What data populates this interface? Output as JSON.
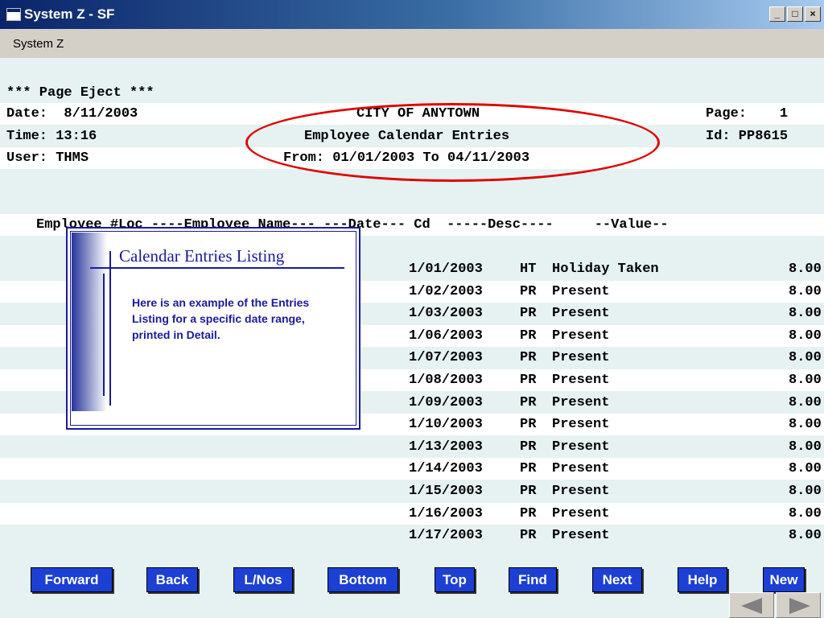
{
  "window": {
    "title": "System Z - SF",
    "min_glyph": "_",
    "max_glyph": "□",
    "close_glyph": "×"
  },
  "menubar": {
    "menu_label": "System Z"
  },
  "report": {
    "page_eject": "*** Page Eject ***",
    "date_line": "Date:  8/11/2003",
    "time_line": "Time: 13:16",
    "user_line": "User: THMS",
    "org": "CITY OF ANYTOWN",
    "report_title": "Employee Calendar Entries",
    "range": "From: 01/01/2003 To 04/11/2003",
    "page_line": "Page:    1",
    "id_line": "Id: PP8615",
    "column_header": "Employee #Loc ----Employee Name--- ---Date--- Cd  -----Desc----     --Value--",
    "rows": [
      {
        "date": "1/01/2003",
        "cd": "HT",
        "desc": "Holiday Taken",
        "value": "8.00"
      },
      {
        "date": "1/02/2003",
        "cd": "PR",
        "desc": "Present",
        "value": "8.00"
      },
      {
        "date": "1/03/2003",
        "cd": "PR",
        "desc": "Present",
        "value": "8.00"
      },
      {
        "date": "1/06/2003",
        "cd": "PR",
        "desc": "Present",
        "value": "8.00"
      },
      {
        "date": "1/07/2003",
        "cd": "PR",
        "desc": "Present",
        "value": "8.00"
      },
      {
        "date": "1/08/2003",
        "cd": "PR",
        "desc": "Present",
        "value": "8.00"
      },
      {
        "date": "1/09/2003",
        "cd": "PR",
        "desc": "Present",
        "value": "8.00"
      },
      {
        "date": "1/10/2003",
        "cd": "PR",
        "desc": "Present",
        "value": "8.00"
      },
      {
        "date": "1/13/2003",
        "cd": "PR",
        "desc": "Present",
        "value": "8.00"
      },
      {
        "date": "1/14/2003",
        "cd": "PR",
        "desc": "Present",
        "value": "8.00"
      },
      {
        "date": "1/15/2003",
        "cd": "PR",
        "desc": "Present",
        "value": "8.00"
      },
      {
        "date": "1/16/2003",
        "cd": "PR",
        "desc": "Present",
        "value": "8.00"
      },
      {
        "date": "1/17/2003",
        "cd": "PR",
        "desc": "Present",
        "value": "8.00"
      }
    ]
  },
  "callout": {
    "title": "Calendar Entries Listing",
    "text": "Here is an example of the Entries Listing for a specific date range, printed in Detail."
  },
  "buttons": {
    "forward": "Forward",
    "back": "Back",
    "lnos": "L/Nos",
    "bottom": "Bottom",
    "top": "Top",
    "find": "Find",
    "next": "Next",
    "help": "Help",
    "new": "New"
  },
  "colors": {
    "button_blue": "#1c3fd4",
    "annotation_red": "#e00000",
    "callout_blue": "#1a1aa0"
  },
  "icons": {
    "prev": "triangle-left-icon",
    "next": "triangle-right-icon"
  }
}
